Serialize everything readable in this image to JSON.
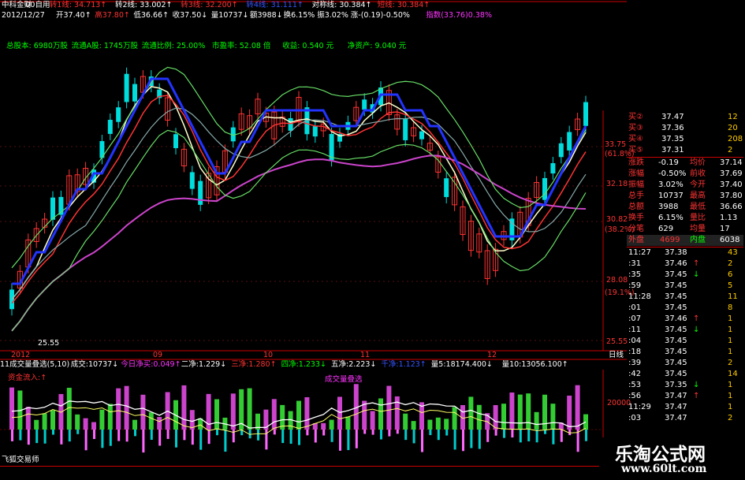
{
  "header": {
    "line1": [
      {
        "text": "中科金财",
        "color": "#ffffff"
      },
      {
        "text": "00自用",
        "color": "#ffffff"
      },
      {
        "text": "转1线: 34.713↑",
        "color": "#ff3333"
      },
      {
        "text": "转2线: 33.002↑",
        "color": "#ffffff"
      },
      {
        "text": "转3线: 32.200↑",
        "color": "#ff3333"
      },
      {
        "text": "转4线: 31.111↑",
        "color": "#3355ff"
      },
      {
        "text": "对称线: 30.384↑",
        "color": "#ffffff"
      },
      {
        "text": "短线: 30.384↑",
        "color": "#ff3333"
      }
    ],
    "line2": [
      {
        "text": "2012/12/27",
        "color": "#ffffff"
      },
      {
        "text": "开37.40↑",
        "color": "#ffffff"
      },
      {
        "text": "高37.80↑",
        "color": "#ff3333"
      },
      {
        "text": "低36.66↑",
        "color": "#ffffff"
      },
      {
        "text": "收37.50↓",
        "color": "#ffffff"
      },
      {
        "text": "量10737↓",
        "color": "#ffffff"
      },
      {
        "text": "额3988↓",
        "color": "#ffffff"
      },
      {
        "text": "换6.15%",
        "color": "#ffffff"
      },
      {
        "text": "振3.02%",
        "color": "#ffffff"
      },
      {
        "text": "涨-(0.19)-0.50%",
        "color": "#ffffff"
      },
      {
        "text": "指数(33.76)0.38%",
        "color": "#ff33ff"
      }
    ],
    "info": [
      {
        "text": "总股本: 6980万股",
        "color": "#00ff00"
      },
      {
        "text": "流通A股: 1745万股",
        "color": "#00ff00"
      },
      {
        "text": "流通比例: 25.00%",
        "color": "#00ff00"
      },
      {
        "text": "市盈率: 52.08 倍",
        "color": "#00ff00"
      },
      {
        "text": "收益: 0.540 元",
        "color": "#00ff00"
      },
      {
        "text": "净资产: 9.040 元",
        "color": "#00ff00"
      }
    ]
  },
  "price_axis": {
    "labels": [
      "33.75",
      "(61.8%)",
      "32.18",
      "30.82",
      "(38.2%)",
      "28.08",
      "(19.1%)",
      "25.55"
    ],
    "low_label": "25.55",
    "day_label": "日线"
  },
  "date_axis": [
    "2012",
    "09",
    "10",
    "11",
    "12"
  ],
  "indicator_bar": [
    {
      "text": "11成交量叠选(5,10)",
      "color": "#ffffff"
    },
    {
      "text": "成交:10737↓",
      "color": "#ffffff"
    },
    {
      "text": "今日净买:0.049↑",
      "color": "#ff33ff"
    },
    {
      "text": "二净:1.229↓",
      "color": "#ffffff"
    },
    {
      "text": "三净:1.280↑",
      "color": "#ff3333"
    },
    {
      "text": "四净:1.233↓",
      "color": "#00ff00"
    },
    {
      "text": "五净:2.223↓",
      "color": "#ffffff"
    },
    {
      "text": "千净:1.123↑",
      "color": "#3355ff"
    },
    {
      "text": "量5:18174.400↓",
      "color": "#ffffff"
    },
    {
      "text": "量10:13056.100↑",
      "color": "#ffffff"
    }
  ],
  "indicator_labels": {
    "fund_inflow": "资金流入:↑",
    "volume_overlay": "成交量叠选",
    "axis_value": "20000"
  },
  "bottom_left": "飞狐交易师",
  "order_book": [
    {
      "label": "买②",
      "price": "37.47",
      "vol": "12"
    },
    {
      "label": "买③",
      "price": "37.36",
      "vol": "20"
    },
    {
      "label": "买④",
      "price": "37.35",
      "vol": "208"
    },
    {
      "label": "买⑤",
      "price": "37.31",
      "vol": "2"
    }
  ],
  "quote_stats": [
    {
      "l": "涨跌",
      "v1": "-0.19",
      "m": "均价",
      "v2": "37.14"
    },
    {
      "l": "涨幅",
      "v1": "-0.50%",
      "m": "前收",
      "v2": "37.69"
    },
    {
      "l": "振幅",
      "v1": "3.02%",
      "m": "今开",
      "v2": "37.40"
    },
    {
      "l": "总手",
      "v1": "10737",
      "m": "最高",
      "v2": "37.80"
    },
    {
      "l": "总额",
      "v1": "3988",
      "m": "最低",
      "v2": "36.66"
    },
    {
      "l": "换手",
      "v1": "6.15%",
      "m": "量比",
      "v2": "1.13"
    },
    {
      "l": "分笔",
      "v1": "629",
      "m": "均量",
      "v2": "17"
    }
  ],
  "outer_inner": {
    "outer_label": "外盘",
    "outer": "4699",
    "inner_label": "内盘",
    "inner": "6038"
  },
  "ticks": [
    {
      "t": "11:27",
      "p": "37.38",
      "a": "",
      "v": "43"
    },
    {
      "t": ":31",
      "p": "37.46",
      "a": "↑",
      "v": "2"
    },
    {
      "t": ":35",
      "p": "37.45",
      "a": "↓",
      "v": "6"
    },
    {
      "t": ":59",
      "p": "37.45",
      "a": "",
      "v": "5"
    },
    {
      "t": "11:28",
      "p": "37.45",
      "a": "",
      "v": "11"
    },
    {
      "t": ":01",
      "p": "37.45",
      "a": "",
      "v": "8"
    },
    {
      "t": ":07",
      "p": "37.46",
      "a": "↑",
      "v": "1"
    },
    {
      "t": ":11",
      "p": "37.45",
      "a": "↓",
      "v": "1"
    },
    {
      "t": ":04",
      "p": "37.45",
      "a": "",
      "v": "1"
    },
    {
      "t": ":18",
      "p": "37.45",
      "a": "",
      "v": "1"
    },
    {
      "t": ":39",
      "p": "37.45",
      "a": "",
      "v": "2"
    },
    {
      "t": ":42",
      "p": "37.45",
      "a": "",
      "v": "14"
    },
    {
      "t": ":53",
      "p": "37.35",
      "a": "↓",
      "v": "1"
    },
    {
      "t": ":56",
      "p": "37.47",
      "a": "↑",
      "v": "1"
    },
    {
      "t": "11:29",
      "p": "37.47",
      "a": "",
      "v": "1"
    },
    {
      "t": ":03",
      "p": "37.47",
      "a": "",
      "v": "2"
    }
  ],
  "watermark": {
    "line1": "乐淘公式网",
    "line2": "www.60lt.com"
  },
  "colors": {
    "up": "#ff3333",
    "down": "#00dddd",
    "bg": "#000000",
    "grid": "#660000",
    "axis": "#cc0000"
  }
}
